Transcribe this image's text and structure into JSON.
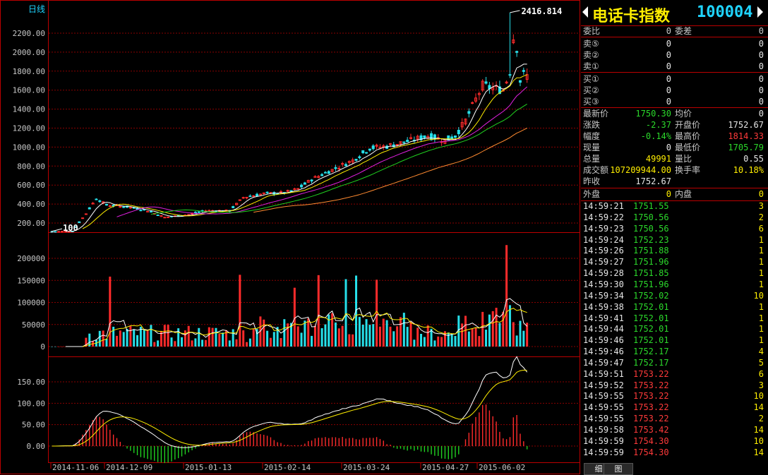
{
  "chart": {
    "period_label": "日线",
    "annotations": {
      "high_label": "2416.814",
      "low_label": "100"
    },
    "price_axis": {
      "ticks": [
        "2200.00",
        "2000.00",
        "1800.00",
        "1600.00",
        "1400.00",
        "1200.00",
        "1000.00",
        "800.00",
        "600.00",
        "400.00",
        "200.00"
      ],
      "values": [
        2200,
        2000,
        1800,
        1600,
        1400,
        1200,
        1000,
        800,
        600,
        400,
        200
      ]
    },
    "volume_axis": {
      "ticks": [
        "200000",
        "150000",
        "100000",
        "50000",
        "0"
      ],
      "values": [
        200000,
        150000,
        100000,
        50000,
        0
      ]
    },
    "macd_axis": {
      "ticks": [
        "150.00",
        "100.00",
        "50.00",
        "0.00"
      ],
      "values": [
        150,
        100,
        50,
        0
      ]
    },
    "date_axis": [
      "2014-11-06",
      "2014-12-09",
      "2015-01-13",
      "2015-02-14",
      "2015-03-24",
      "2015-04-27",
      "2015-06-02"
    ],
    "colors": {
      "up": "#ff2b2b",
      "down": "#27e0ea",
      "grid": "#8a0000",
      "ma5": "#ffffff",
      "ma10": "#ffee00",
      "ma20": "#e020e0",
      "ma30": "#20d020",
      "ma60": "#ff8a30",
      "macd_pos": "#ff2b2b",
      "macd_neg": "#20d020"
    }
  },
  "chart_data": {
    "type": "candlestick",
    "x": [
      "2014-11-06",
      "2014-12-09",
      "2015-01-13",
      "2015-02-14",
      "2015-03-24",
      "2015-04-27",
      "2015-06-02"
    ],
    "close_at_dates": [
      110,
      360,
      320,
      520,
      1000,
      1350,
      2000
    ],
    "high": 2416.814,
    "low": 100,
    "last": 1750.3,
    "ylim_price": [
      100,
      2420
    ],
    "ylim_volume": [
      0,
      230000
    ],
    "ylim_macd": [
      -20,
      190
    ]
  },
  "panel": {
    "title": {
      "name": "电话卡指数",
      "code": "100004"
    },
    "wb": {
      "l1": "委比",
      "v1": "0",
      "l2": "委差",
      "v2": "0"
    },
    "sell": [
      {
        "label": "卖⑤",
        "price": "0",
        "vol": "0"
      },
      {
        "label": "卖②",
        "price": "0",
        "vol": "0"
      },
      {
        "label": "卖①",
        "price": "0",
        "vol": "0"
      }
    ],
    "buy": [
      {
        "label": "买①",
        "price": "0",
        "vol": "0"
      },
      {
        "label": "买②",
        "price": "0",
        "vol": "0"
      },
      {
        "label": "买③",
        "price": "0",
        "vol": "0"
      }
    ],
    "quote": [
      {
        "l1": "最新价",
        "v1": "1750.30",
        "c1": "green",
        "l2": "均价",
        "v2": "0",
        "c2": "white"
      },
      {
        "l1": "涨跌",
        "v1": "-2.37",
        "c1": "green",
        "l2": "开盘价",
        "v2": "1752.67",
        "c2": "white"
      },
      {
        "l1": "幅度",
        "v1": "-0.14%",
        "c1": "green",
        "l2": "最高价",
        "v2": "1814.33",
        "c2": "red"
      },
      {
        "l1": "现量",
        "v1": "0",
        "c1": "white",
        "l2": "最低价",
        "v2": "1705.79",
        "c2": "green"
      },
      {
        "l1": "总量",
        "v1": "49991",
        "c1": "yellow",
        "l2": "量比",
        "v2": "0.55",
        "c2": "white"
      },
      {
        "l1": "成交额",
        "v1": "107209944.00",
        "c1": "yellow",
        "l2": "换手率",
        "v2": "10.18%",
        "c2": "yellow"
      }
    ],
    "prev": {
      "label": "昨收",
      "value": "1752.67"
    },
    "outer": {
      "l1": "外盘",
      "v1": "0",
      "l2": "内盘",
      "v2": "0"
    },
    "ticks": [
      {
        "time": "14:59:21",
        "price": "1751.55",
        "vol": "3",
        "color": "green"
      },
      {
        "time": "14:59:22",
        "price": "1750.56",
        "vol": "2",
        "color": "green"
      },
      {
        "time": "14:59:23",
        "price": "1750.56",
        "vol": "6",
        "color": "green"
      },
      {
        "time": "14:59:24",
        "price": "1752.23",
        "vol": "1",
        "color": "green"
      },
      {
        "time": "14:59:26",
        "price": "1751.88",
        "vol": "1",
        "color": "green"
      },
      {
        "time": "14:59:27",
        "price": "1751.96",
        "vol": "1",
        "color": "green"
      },
      {
        "time": "14:59:28",
        "price": "1751.85",
        "vol": "1",
        "color": "green"
      },
      {
        "time": "14:59:30",
        "price": "1751.96",
        "vol": "1",
        "color": "green"
      },
      {
        "time": "14:59:34",
        "price": "1752.02",
        "vol": "10",
        "color": "green"
      },
      {
        "time": "14:59:38",
        "price": "1752.01",
        "vol": "1",
        "color": "green"
      },
      {
        "time": "14:59:41",
        "price": "1752.01",
        "vol": "1",
        "color": "green"
      },
      {
        "time": "14:59:44",
        "price": "1752.01",
        "vol": "1",
        "color": "green"
      },
      {
        "time": "14:59:46",
        "price": "1752.01",
        "vol": "1",
        "color": "green"
      },
      {
        "time": "14:59:46",
        "price": "1752.17",
        "vol": "4",
        "color": "green"
      },
      {
        "time": "14:59:47",
        "price": "1752.17",
        "vol": "5",
        "color": "green"
      },
      {
        "time": "14:59:51",
        "price": "1753.22",
        "vol": "6",
        "color": "red"
      },
      {
        "time": "14:59:52",
        "price": "1753.22",
        "vol": "3",
        "color": "red"
      },
      {
        "time": "14:59:55",
        "price": "1753.22",
        "vol": "10",
        "color": "red"
      },
      {
        "time": "14:59:55",
        "price": "1753.22",
        "vol": "14",
        "color": "red"
      },
      {
        "time": "14:59:55",
        "price": "1753.22",
        "vol": "2",
        "color": "red"
      },
      {
        "time": "14:59:58",
        "price": "1753.42",
        "vol": "14",
        "color": "red"
      },
      {
        "time": "14:59:59",
        "price": "1754.30",
        "vol": "10",
        "color": "red"
      },
      {
        "time": "14:59:59",
        "price": "1754.30",
        "vol": "14",
        "color": "red"
      }
    ],
    "tabs": [
      "细",
      "图"
    ]
  }
}
